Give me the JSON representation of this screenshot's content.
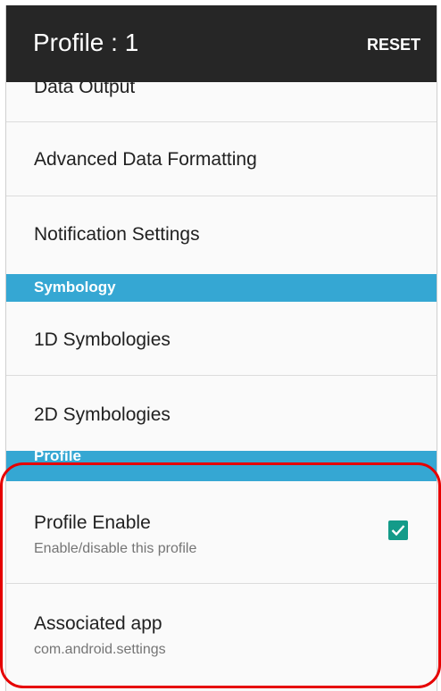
{
  "appbar": {
    "title": "Profile : 1",
    "reset_label": "RESET"
  },
  "settings": {
    "data_output": "Data Output",
    "advanced_data_formatting": "Advanced Data Formatting",
    "notification_settings": "Notification Settings",
    "symbology_header": "Symbology",
    "symbologies_1d": "1D Symbologies",
    "symbologies_2d": "2D Symbologies",
    "profile_header": "Profile",
    "profile_enable": {
      "label": "Profile Enable",
      "summary": "Enable/disable this profile",
      "checked": true
    },
    "associated_app": {
      "label": "Associated app",
      "summary": "com.android.settings"
    }
  },
  "colors": {
    "appbar_bg": "#262626",
    "section_header_bg": "#35a7d3",
    "checkbox_accent": "#139b89",
    "highlight_border": "#e60000"
  },
  "icons": {
    "checkbox": "checkmark-icon"
  }
}
